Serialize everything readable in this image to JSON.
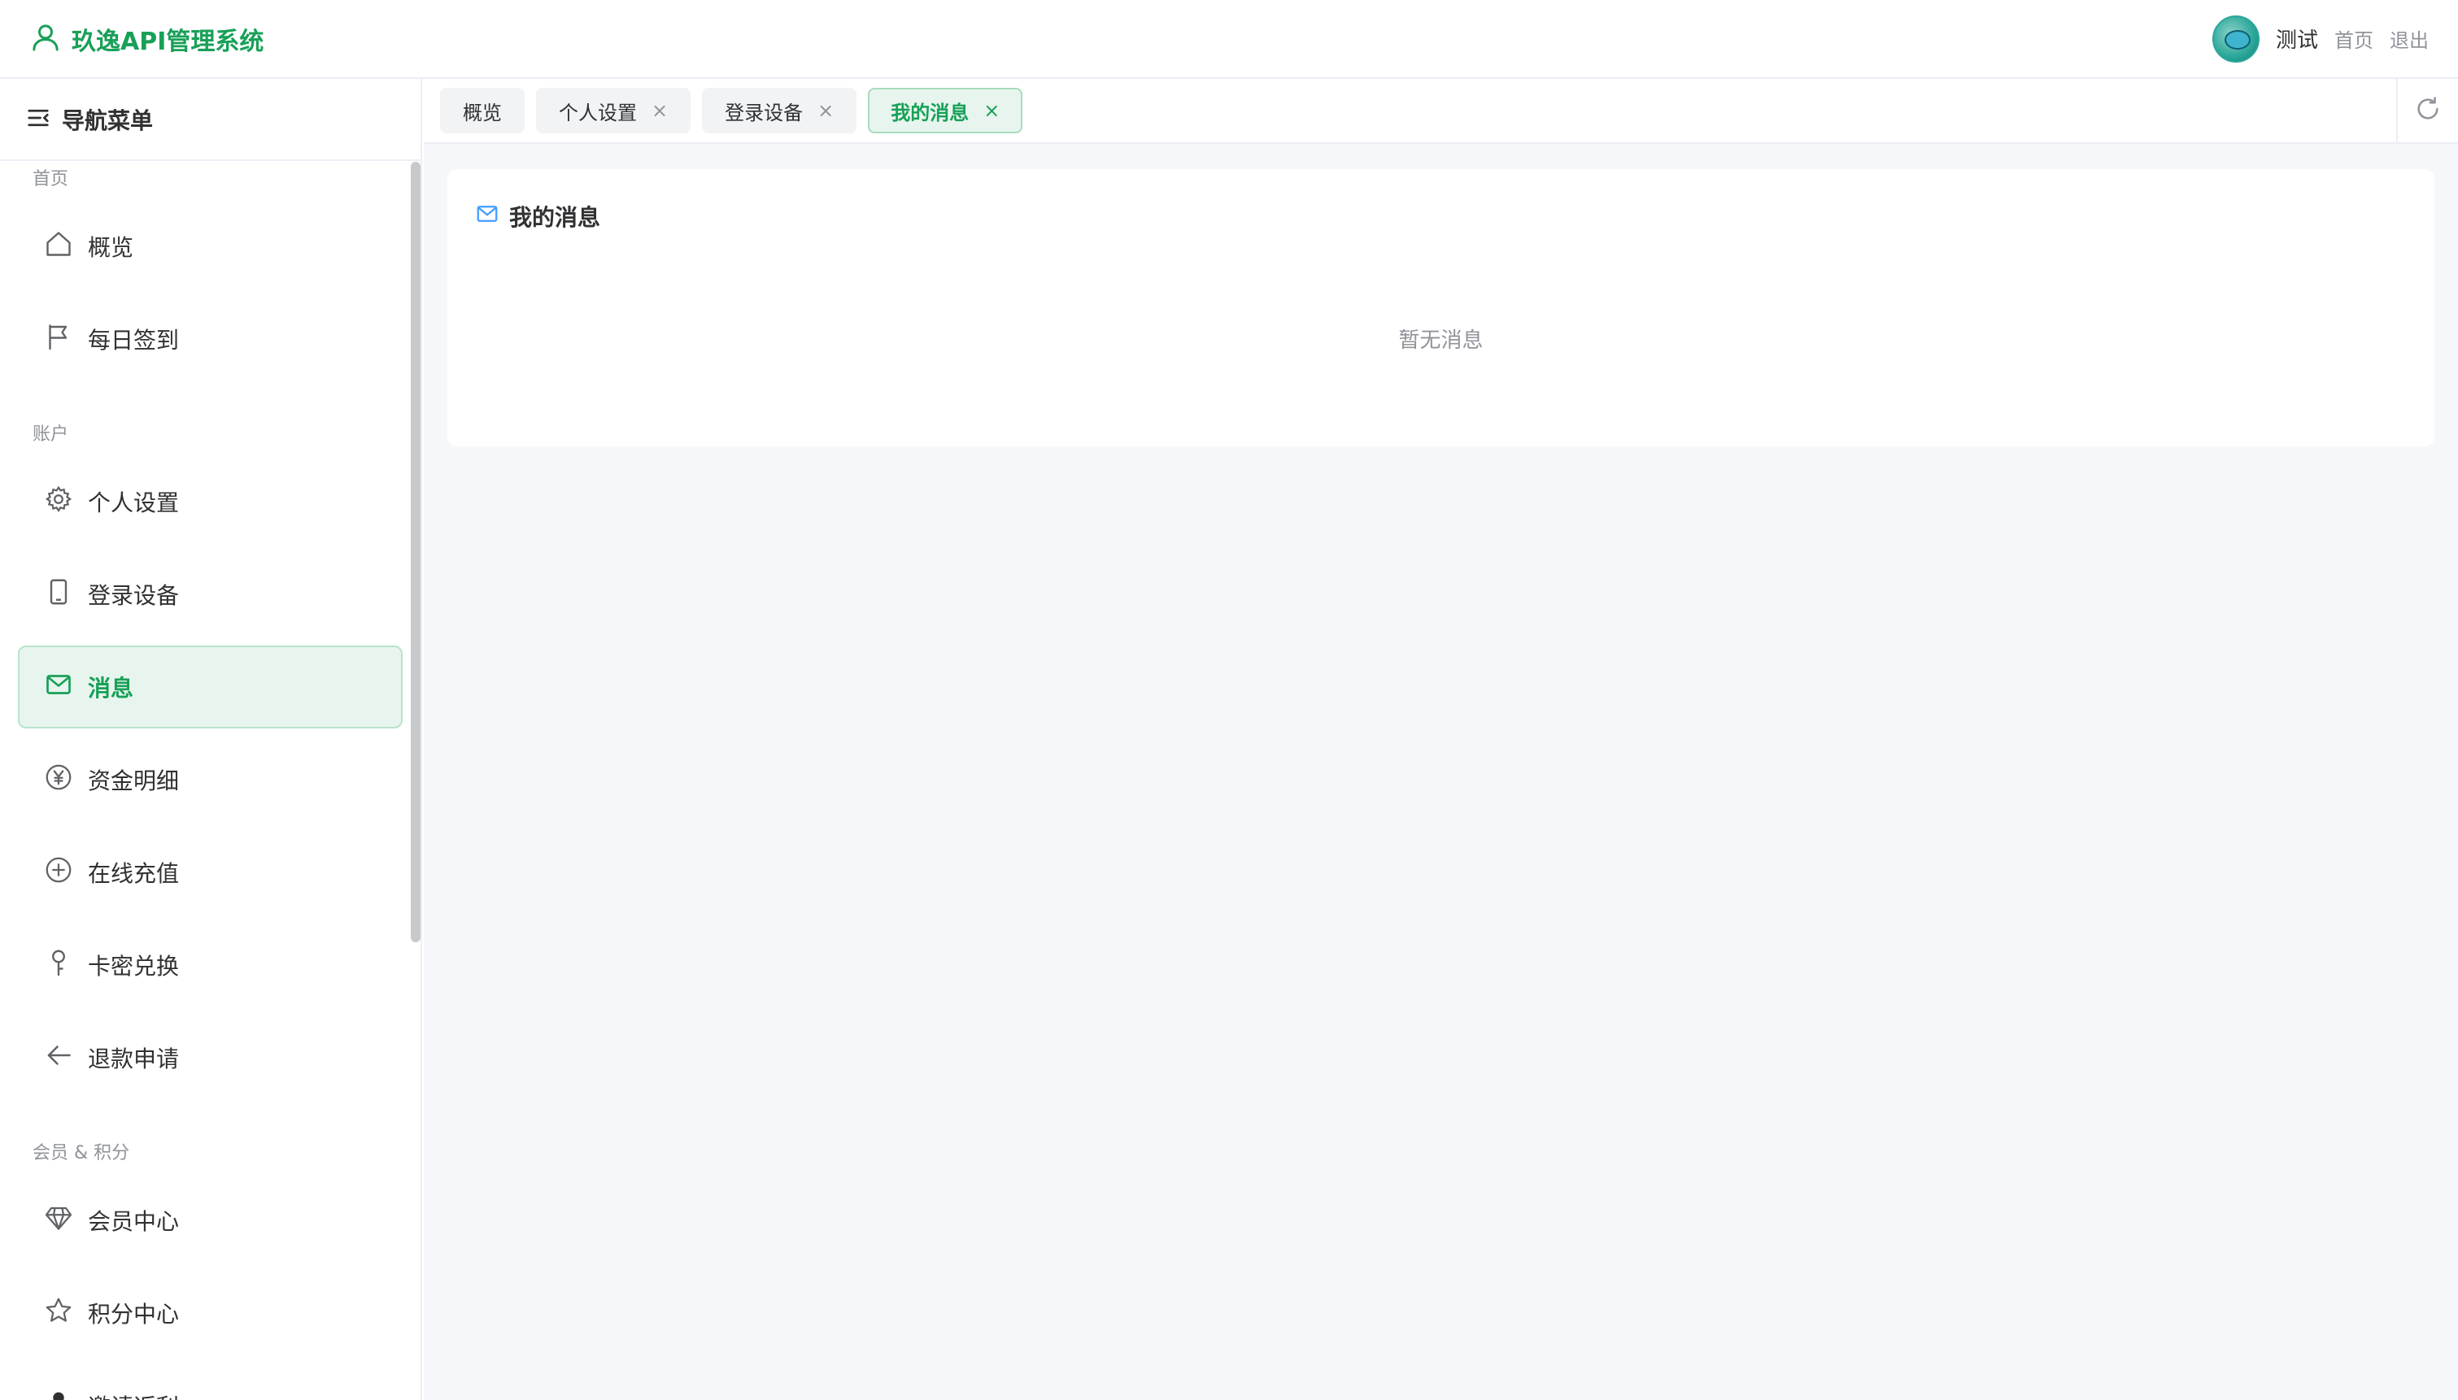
{
  "header": {
    "brand_title": "玖逸API管理系统",
    "username": "测试",
    "links": [
      "首页",
      "退出"
    ]
  },
  "sidebar": {
    "title": "导航菜单",
    "groups": [
      {
        "label": "首页",
        "items": [
          {
            "label": "概览",
            "icon": "home-icon"
          },
          {
            "label": "每日签到",
            "icon": "flag-icon"
          }
        ]
      },
      {
        "label": "账户",
        "items": [
          {
            "label": "个人设置",
            "icon": "gear-icon"
          },
          {
            "label": "登录设备",
            "icon": "phone-icon"
          },
          {
            "label": "消息",
            "icon": "mail-icon",
            "active": true
          },
          {
            "label": "资金明细",
            "icon": "yen-icon"
          },
          {
            "label": "在线充值",
            "icon": "plus-circle-icon"
          },
          {
            "label": "卡密兑换",
            "icon": "key-icon"
          },
          {
            "label": "退款申请",
            "icon": "arrow-left-icon"
          }
        ]
      },
      {
        "label": "会员 & 积分",
        "items": [
          {
            "label": "会员中心",
            "icon": "diamond-icon"
          },
          {
            "label": "积分中心",
            "icon": "star-icon"
          },
          {
            "label": "邀请返利",
            "icon": "user-icon"
          }
        ]
      }
    ]
  },
  "tabs": [
    {
      "label": "概览",
      "closable": false
    },
    {
      "label": "个人设置",
      "closable": true
    },
    {
      "label": "登录设备",
      "closable": true
    },
    {
      "label": "我的消息",
      "closable": true,
      "active": true
    }
  ],
  "tab_close_glyph": "×",
  "main": {
    "card_title": "我的消息",
    "empty_text": "暂无消息"
  },
  "colors": {
    "accent": "#18a058",
    "active_bg": "#e8f5ee",
    "mail_icon": "#409eff"
  }
}
